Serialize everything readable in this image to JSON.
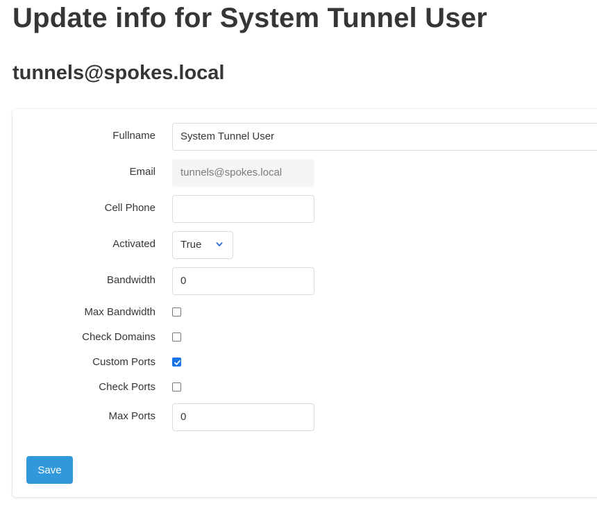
{
  "header": {
    "title": "Update info for System Tunnel User",
    "subtitle": "tunnels@spokes.local"
  },
  "form": {
    "fullname": {
      "label": "Fullname",
      "value": "System Tunnel User"
    },
    "email": {
      "label": "Email",
      "value": "tunnels@spokes.local",
      "disabled": true
    },
    "cell_phone": {
      "label": "Cell Phone",
      "value": ""
    },
    "activated": {
      "label": "Activated",
      "value": "True",
      "icon": "chevron-down-icon"
    },
    "bandwidth": {
      "label": "Bandwidth",
      "value": "0"
    },
    "max_bandwidth": {
      "label": "Max Bandwidth",
      "checked": false
    },
    "check_domains": {
      "label": "Check Domains",
      "checked": false
    },
    "custom_ports": {
      "label": "Custom Ports",
      "checked": true
    },
    "check_ports": {
      "label": "Check Ports",
      "checked": false
    },
    "max_ports": {
      "label": "Max Ports",
      "value": "0"
    },
    "save_label": "Save"
  },
  "colors": {
    "primary_button": "#3298dc",
    "checkbox_checked": "#1a73e8",
    "chevron": "#3273dc"
  }
}
